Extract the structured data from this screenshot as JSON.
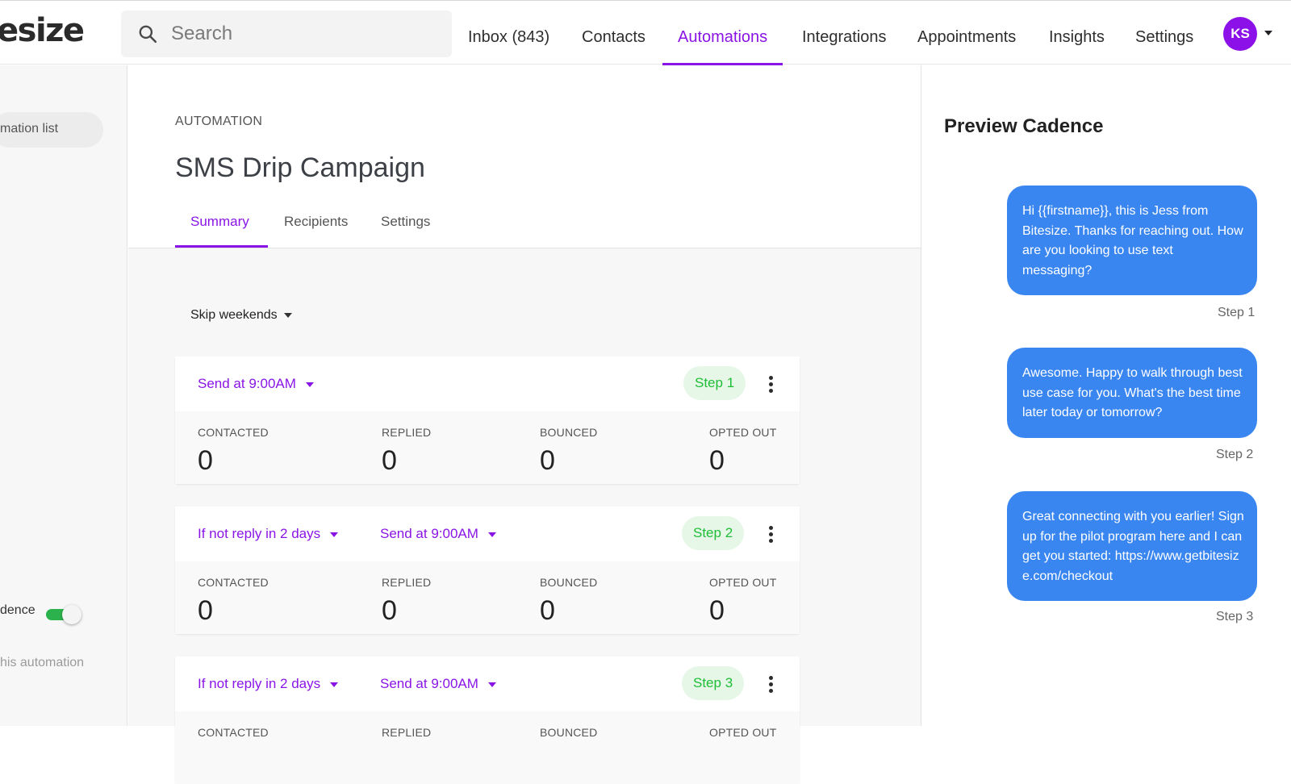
{
  "topbar": {
    "logo_text": "esize",
    "search_placeholder": "Search",
    "nav": {
      "inbox": "Inbox  (843)",
      "contacts": "Contacts",
      "automations": "Automations",
      "integrations": "Integrations",
      "appointments": "Appointments",
      "insights": "Insights",
      "settings": "Settings"
    },
    "active_nav": "Automations",
    "avatar_initials": "KS"
  },
  "sidebar": {
    "back_label": "mation list",
    "frag1": "",
    "frag2": "",
    "cadence_label": "dence",
    "cadence_enabled": true,
    "auto_label": "his automation"
  },
  "main": {
    "overline": "AUTOMATION",
    "title": "SMS Drip Campaign",
    "tabs": [
      "Summary",
      "Recipients",
      "Settings"
    ],
    "active_tab": "Summary",
    "skip_label": "Skip weekends",
    "stat_labels": {
      "contacted": "CONTACTED",
      "replied": "REPLIED",
      "bounced": "BOUNCED",
      "opted_out": "OPTED OUT"
    },
    "steps": [
      {
        "condition": "",
        "send": "Send at 9:00AM",
        "step_label": "Step 1",
        "contacted": "0",
        "replied": "0",
        "bounced": "0",
        "opted_out": "0"
      },
      {
        "condition": "If not reply in 2 days",
        "send": "Send at 9:00AM",
        "step_label": "Step 2",
        "contacted": "0",
        "replied": "0",
        "bounced": "0",
        "opted_out": "0"
      },
      {
        "condition": "If not reply in 2 days",
        "send": "Send at 9:00AM",
        "step_label": "Step 3",
        "contacted": "",
        "replied": "",
        "bounced": "",
        "opted_out": ""
      }
    ]
  },
  "preview": {
    "title": "Preview Cadence",
    "messages": [
      {
        "text": "Hi {{firstname}}, this is Jess from Bitesize. Thanks for reaching out. How are you looking to use text messaging?",
        "step": "Step 1"
      },
      {
        "text": "Awesome. Happy to walk through best use case for you. What's the best time later today or tomorrow?",
        "step": "Step 2"
      },
      {
        "text": "Great connecting with you earlier! Sign up for the pilot program here and I can get you started: https://www.getbitesize.com/checkout",
        "step": "Step 3"
      }
    ]
  },
  "colors": {
    "accent": "#8a14e6",
    "step_badge_bg": "#e6f7e8",
    "step_badge_text": "#1fbd36",
    "bubble": "#3a86f0",
    "toggle_on": "#2bb24c"
  }
}
